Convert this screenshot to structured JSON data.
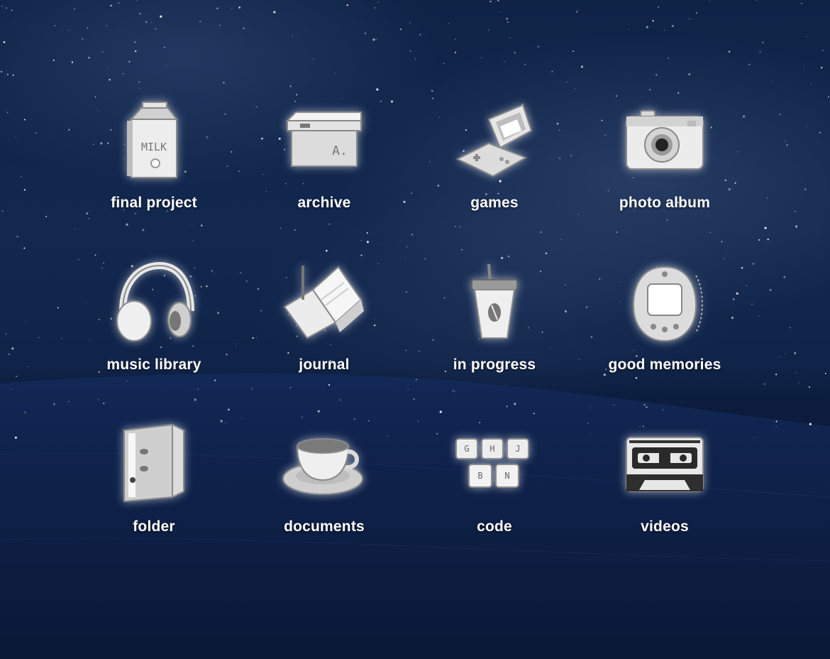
{
  "desktop": {
    "items": [
      {
        "label": "final project",
        "icon": "milk-carton-icon"
      },
      {
        "label": "archive",
        "icon": "storage-box-icon"
      },
      {
        "label": "games",
        "icon": "handheld-console-icon"
      },
      {
        "label": "photo album",
        "icon": "camera-icon"
      },
      {
        "label": "music library",
        "icon": "headphones-icon"
      },
      {
        "label": "journal",
        "icon": "open-book-icon"
      },
      {
        "label": "in progress",
        "icon": "coffee-cup-icon"
      },
      {
        "label": "good memories",
        "icon": "virtual-pet-icon"
      },
      {
        "label": "folder",
        "icon": "binder-icon"
      },
      {
        "label": "documents",
        "icon": "teacup-icon"
      },
      {
        "label": "code",
        "icon": "keyboard-keys-icon"
      },
      {
        "label": "videos",
        "icon": "cassette-tape-icon"
      }
    ],
    "icon_text": {
      "milk": "MILK",
      "box": "A.",
      "keys": [
        "G",
        "H",
        "J",
        "B",
        "N"
      ]
    },
    "colors": {
      "background": "#0b1a38",
      "label": "#ffffff",
      "icon_fill": "#e8e8e8"
    }
  }
}
